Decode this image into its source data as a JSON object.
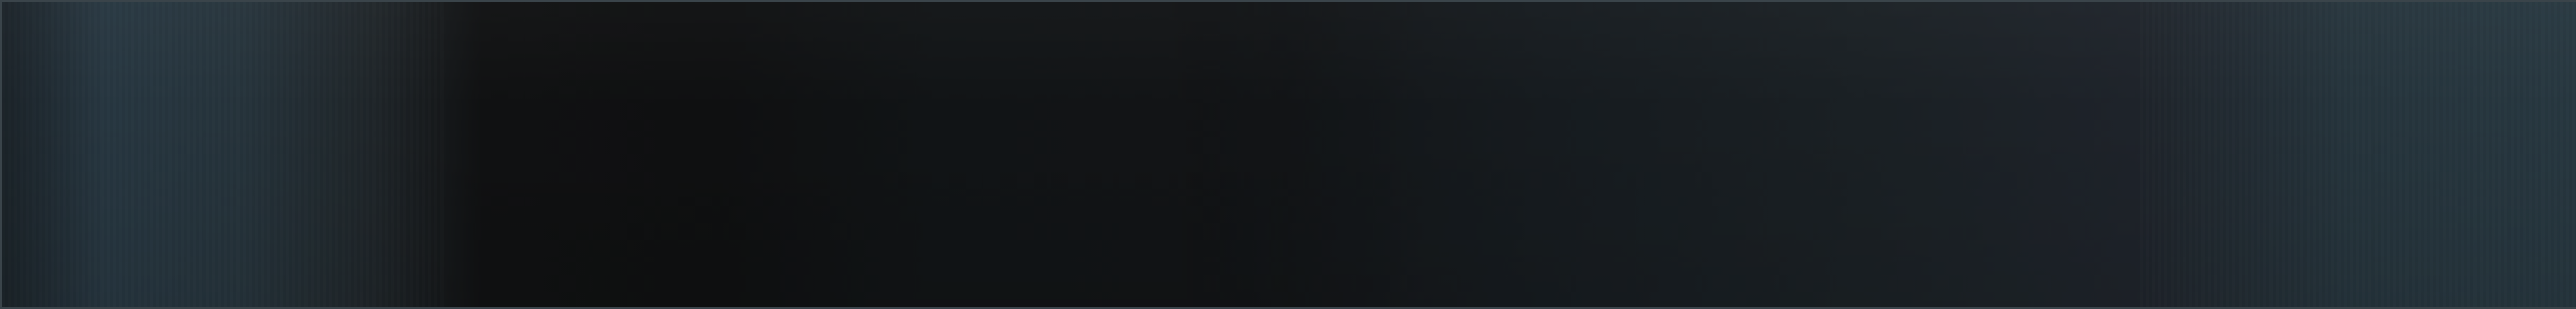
{
  "window": {
    "visible_text": []
  },
  "background": {
    "main_colors": [
      "#202a31",
      "#263640",
      "#101112",
      "#161b1f",
      "#273841"
    ],
    "border_color": "#3a444a"
  }
}
